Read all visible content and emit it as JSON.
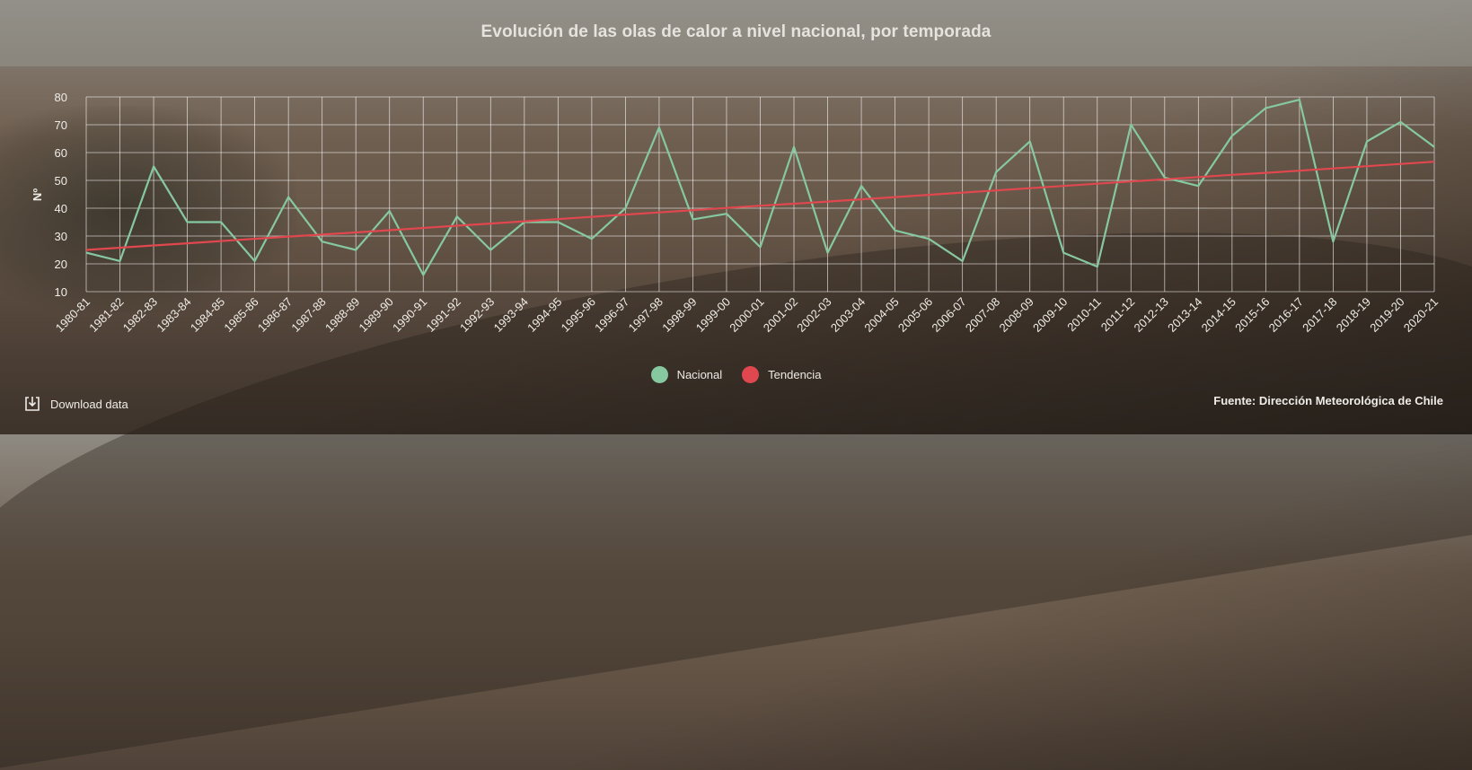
{
  "title": "Evolución de las olas de calor a nivel nacional, por temporada",
  "download_label": "Download data",
  "source": "Fuente: Dirección Meteorológica de Chile",
  "icons": {
    "download": "download-icon"
  },
  "chart_data": {
    "type": "line",
    "title": "Evolución de las olas de calor a nivel nacional, por temporada",
    "ylabel": "Nº",
    "xlabel": "",
    "ylim": [
      10,
      80
    ],
    "yticks": [
      10,
      20,
      30,
      40,
      50,
      60,
      70,
      80
    ],
    "grid": true,
    "legend_position": "bottom-center",
    "categories": [
      "1980-81",
      "1981-82",
      "1982-83",
      "1983-84",
      "1984-85",
      "1985-86",
      "1986-87",
      "1987-88",
      "1988-89",
      "1989-90",
      "1990-91",
      "1991-92",
      "1992-93",
      "1993-94",
      "1994-95",
      "1995-96",
      "1996-97",
      "1997-98",
      "1998-99",
      "1999-00",
      "2000-01",
      "2001-02",
      "2002-03",
      "2003-04",
      "2004-05",
      "2005-06",
      "2006-07",
      "2007-08",
      "2008-09",
      "2009-10",
      "2010-11",
      "2011-12",
      "2012-13",
      "2013-14",
      "2014-15",
      "2015-16",
      "2016-17",
      "2017-18",
      "2018-19",
      "2019-20",
      "2020-21"
    ],
    "series": [
      {
        "name": "Nacional",
        "color": "#86c8a0",
        "values": [
          24,
          21,
          55,
          35,
          35,
          21,
          44,
          28,
          25,
          39,
          16,
          37,
          25,
          35,
          35,
          29,
          40,
          69,
          36,
          38,
          26,
          62,
          24,
          48,
          32,
          29,
          21,
          53,
          64,
          24,
          19,
          70,
          51,
          48,
          66,
          76,
          79,
          28,
          64,
          71,
          62
        ]
      },
      {
        "name": "Tendencia",
        "color": "#e0474f",
        "values": [
          25.0,
          25.8,
          26.6,
          27.4,
          28.2,
          29.0,
          29.8,
          30.5,
          31.3,
          32.1,
          32.9,
          33.7,
          34.5,
          35.3,
          36.1,
          36.9,
          37.7,
          38.5,
          39.3,
          40.1,
          40.9,
          41.6,
          42.4,
          43.2,
          44.0,
          44.8,
          45.6,
          46.4,
          47.2,
          48.0,
          48.8,
          49.6,
          50.4,
          51.2,
          52.0,
          52.7,
          53.5,
          54.3,
          55.1,
          55.9,
          56.7
        ]
      }
    ]
  }
}
